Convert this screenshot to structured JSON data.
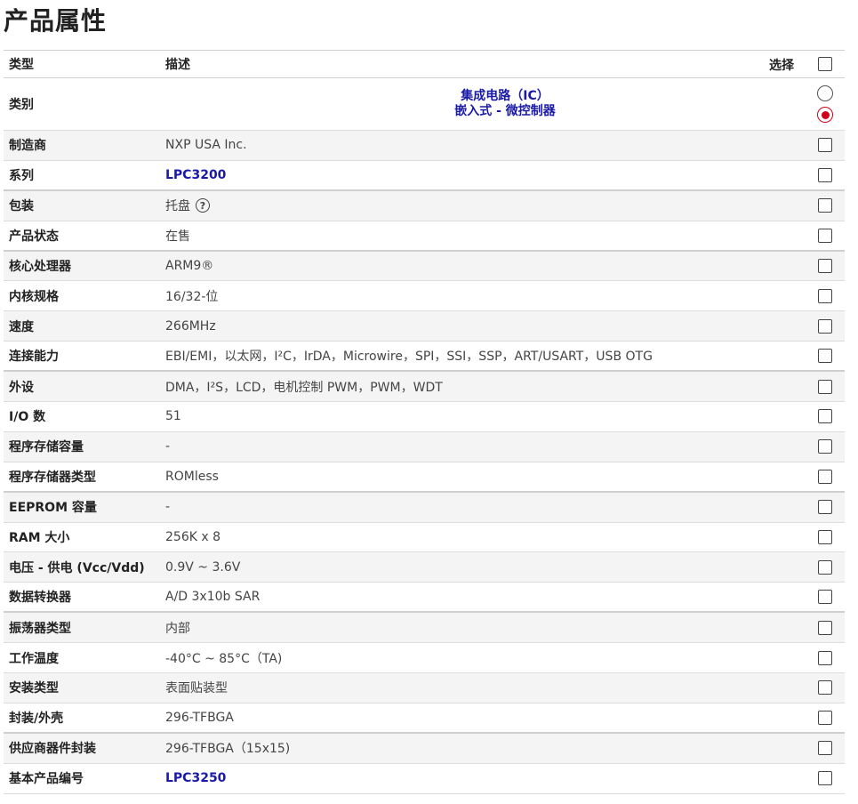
{
  "page": {
    "title": "产品属性"
  },
  "header": {
    "type_label": "类型",
    "desc_label": "描述",
    "select_label": "选择"
  },
  "category": {
    "type": "类别",
    "lines": [
      "集成电路（IC）",
      "嵌入式 - 微控制器"
    ]
  },
  "rows": [
    {
      "type": "制造商",
      "desc": "NXP USA Inc."
    },
    {
      "type": "系列",
      "desc": "LPC3200"
    },
    {
      "type": "包装",
      "desc": "托盘"
    },
    {
      "type": "产品状态",
      "desc": "在售"
    },
    {
      "type": "核心处理器",
      "desc": "ARM9®"
    },
    {
      "type": "内核规格",
      "desc": "16/32-位"
    },
    {
      "type": "速度",
      "desc": "266MHz"
    },
    {
      "type": "连接能力",
      "desc": "EBI/EMI，以太网，I²C，IrDA，Microwire，SPI，SSI，SSP，ART/USART，USB OTG"
    },
    {
      "type": "外设",
      "desc": "DMA，I²S，LCD，电机控制 PWM，PWM，WDT"
    },
    {
      "type": "I/O 数",
      "desc": "51"
    },
    {
      "type": "程序存储容量",
      "desc": "-"
    },
    {
      "type": "程序存储器类型",
      "desc": "ROMless"
    },
    {
      "type": "EEPROM 容量",
      "desc": "-"
    },
    {
      "type": "RAM 大小",
      "desc": "256K x 8"
    },
    {
      "type": "电压 - 供电 (Vcc/Vdd)",
      "desc": "0.9V ~ 3.6V"
    },
    {
      "type": "数据转换器",
      "desc": "A/D 3x10b SAR"
    },
    {
      "type": "振荡器类型",
      "desc": "内部"
    },
    {
      "type": "工作温度",
      "desc": "-40°C ~ 85°C（TA)"
    },
    {
      "type": "安装类型",
      "desc": "表面贴装型"
    },
    {
      "type": "封装/外壳",
      "desc": "296-TFBGA"
    },
    {
      "type": "供应商器件封装",
      "desc": "296-TFBGA（15x15)"
    },
    {
      "type": "基本产品编号",
      "desc": "LPC3250"
    }
  ],
  "icons": {
    "help": "question-circle-icon",
    "help_glyph": "?"
  },
  "colors": {
    "link": "#1a1aa6",
    "radio_selected": "#d0021b",
    "row_shade": "#f4f4f4"
  }
}
